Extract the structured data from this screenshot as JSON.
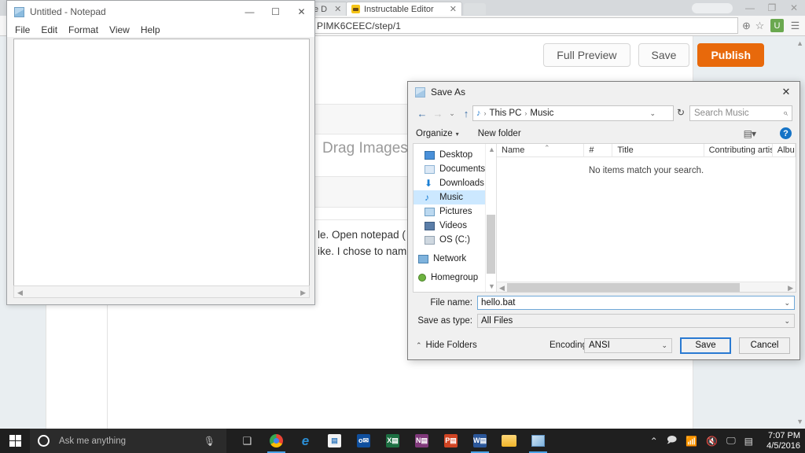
{
  "browser": {
    "tabs": [
      {
        "label": "e D",
        "active": false,
        "close_icon": "✕"
      },
      {
        "label": "Instructable Editor",
        "active": true,
        "close_icon": "✕"
      }
    ],
    "url": "PIMK6CEEC/step/1",
    "window_controls": {
      "minimize": "—",
      "maximize": "❐",
      "close": "✕"
    },
    "toolbar_icons": {
      "zoom": "⊕",
      "bookmark": "☆",
      "extension": "U",
      "menu": "☰"
    }
  },
  "page": {
    "buttons": [
      {
        "label": "Full Preview",
        "style": "default"
      },
      {
        "label": "Save",
        "style": "default"
      },
      {
        "label": "Publish",
        "style": "primary"
      }
    ],
    "drag_images_placeholder": "Drag Images",
    "body_text_line1": "le. Open notepad (",
    "body_text_line2": "ike. I chose to nam",
    "accent_color": "#e8690b"
  },
  "notepad": {
    "title": "Untitled - Notepad",
    "menu": [
      "File",
      "Edit",
      "Format",
      "View",
      "Help"
    ],
    "window_controls": {
      "minimize": "—",
      "maximize": "☐",
      "close": "✕"
    },
    "content": ""
  },
  "save_as": {
    "title": "Save As",
    "close_icon": "✕",
    "nav": {
      "back": "←",
      "forward": "→",
      "recent": "⌄",
      "up": "↑"
    },
    "breadcrumb": {
      "icon": "♪",
      "items": [
        "This PC",
        "Music"
      ],
      "separator": "›",
      "caret": "⌄"
    },
    "refresh_icon": "↻",
    "search": {
      "placeholder": "Search Music",
      "icon": "⌕"
    },
    "toolbar": {
      "organize": "Organize",
      "organize_caret": "▾",
      "new_folder": "New folder",
      "view_icon": "▤▾",
      "help_icon": "?"
    },
    "sidebar": [
      {
        "label": "Desktop",
        "selected": false,
        "icon": "desktop-icon"
      },
      {
        "label": "Documents",
        "selected": false,
        "icon": "documents-icon"
      },
      {
        "label": "Downloads",
        "selected": false,
        "icon": "downloads-icon"
      },
      {
        "label": "Music",
        "selected": true,
        "icon": "music-icon"
      },
      {
        "label": "Pictures",
        "selected": false,
        "icon": "pictures-icon"
      },
      {
        "label": "Videos",
        "selected": false,
        "icon": "videos-icon"
      },
      {
        "label": "OS (C:)",
        "selected": false,
        "icon": "drive-icon"
      },
      {
        "label": "Network",
        "selected": false,
        "icon": "network-icon"
      },
      {
        "label": "Homegroup",
        "selected": false,
        "icon": "homegroup-icon"
      }
    ],
    "columns": [
      "Name",
      "#",
      "Title",
      "Contributing artists",
      "Albu"
    ],
    "sort_indicator": "⌃",
    "empty_message": "No items match your search.",
    "file_name_label": "File name:",
    "file_name_value": "hello.bat",
    "save_as_type_label": "Save as type:",
    "save_as_type_value": "All Files",
    "encoding_label": "Encoding:",
    "encoding_value": "ANSI",
    "hide_folders_label": "Hide Folders",
    "hide_folders_caret": "⌃",
    "save_button": "Save",
    "cancel_button": "Cancel",
    "dropdown_caret": "⌄"
  },
  "taskbar": {
    "search_placeholder": "Ask me anything",
    "mic_icon": "🎤",
    "task_view_icon": "❑",
    "apps": [
      {
        "name": "chrome",
        "label": ""
      },
      {
        "name": "edge",
        "label": "e"
      },
      {
        "name": "store",
        "label": "▤"
      },
      {
        "name": "outlook",
        "label": "o✉"
      },
      {
        "name": "excel",
        "label": "X"
      },
      {
        "name": "onenote",
        "label": "N"
      },
      {
        "name": "powerpoint",
        "label": "P"
      },
      {
        "name": "word",
        "label": "W"
      },
      {
        "name": "file-explorer",
        "label": ""
      },
      {
        "name": "notepad",
        "label": ""
      }
    ],
    "tray": [
      "⌃",
      "🗩",
      "📶",
      "🔇",
      "🖵",
      "▤"
    ],
    "time": "7:07 PM",
    "date": "4/5/2016"
  }
}
